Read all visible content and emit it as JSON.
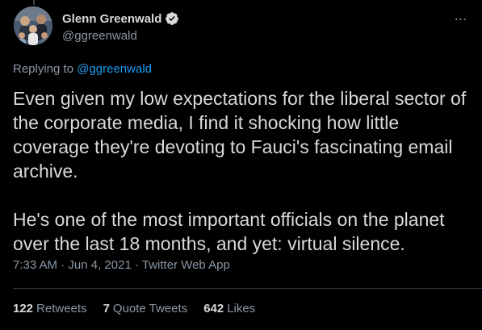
{
  "author": {
    "display_name": "Glenn Greenwald",
    "handle": "@ggreenwald",
    "verified": true
  },
  "more_icon": "⋯",
  "replying": {
    "prefix": "Replying to",
    "mention": "@ggreenwald"
  },
  "tweet": {
    "paragraph_1": "Even given my low expectations for the liberal sector of the corporate media, I find it shocking how little coverage they're devoting to Fauci's fascinating email archive.",
    "paragraph_2": "He's one of the most important officials on the planet over the last 18 months, and yet: virtual silence."
  },
  "meta": {
    "time": "7:33 AM",
    "separator": " · ",
    "date": "Jun 4, 2021",
    "source": "Twitter Web App"
  },
  "stats": {
    "retweets_count": "122",
    "retweets_label": "Retweets",
    "quotes_count": "7",
    "quotes_label": "Quote Tweets",
    "likes_count": "642",
    "likes_label": "Likes"
  },
  "colors": {
    "background": "#000000",
    "text": "#d9d9d9",
    "secondary": "#8b98a5",
    "link": "#1d9bf0",
    "divider": "#2f3336"
  }
}
